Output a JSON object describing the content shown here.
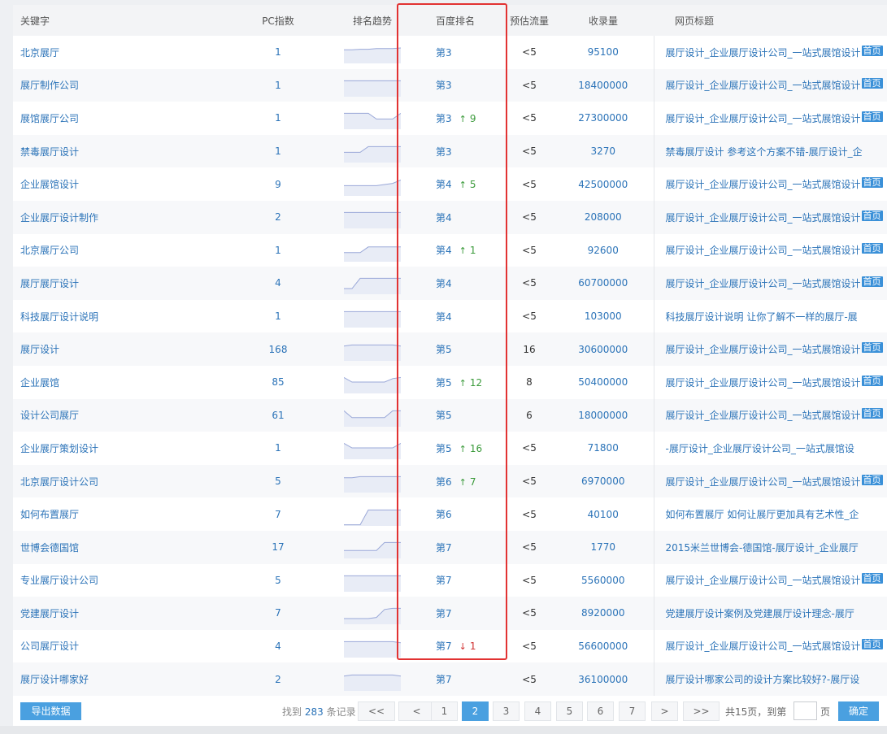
{
  "columns": {
    "keyword": "关键字",
    "pc_index": "PC指数",
    "trend": "排名趋势",
    "baidu_rank": "百度排名",
    "est_traffic": "预估流量",
    "indexed": "收录量",
    "page_title": "网页标题"
  },
  "badge_label": "首页",
  "rows": [
    {
      "keyword": "北京展厅",
      "pc": "1",
      "trend": [
        0.4,
        0.4,
        0.38,
        0.38,
        0.35,
        0.35,
        0.35,
        0.32
      ],
      "rank": "第3",
      "dir": "",
      "chg": "",
      "flow": "<5",
      "indexed": "95100",
      "title": "展厅设计_企业展厅设计公司_一站式展馆设计",
      "badge": true
    },
    {
      "keyword": "展厅制作公司",
      "pc": "1",
      "trend": [
        0.3,
        0.3,
        0.3,
        0.3,
        0.3,
        0.3,
        0.3,
        0.3
      ],
      "rank": "第3",
      "dir": "",
      "chg": "",
      "flow": "<5",
      "indexed": "18400000",
      "title": "展厅设计_企业展厅设计公司_一站式展馆设计",
      "badge": true
    },
    {
      "keyword": "展馆展厅公司",
      "pc": "1",
      "trend": [
        0.3,
        0.3,
        0.3,
        0.3,
        0.55,
        0.55,
        0.55,
        0.3
      ],
      "rank": "第3",
      "dir": "up",
      "chg": "9",
      "flow": "<5",
      "indexed": "27300000",
      "title": "展厅设计_企业展厅设计公司_一站式展馆设计",
      "badge": true
    },
    {
      "keyword": "禁毒展厅设计",
      "pc": "1",
      "trend": [
        0.55,
        0.55,
        0.55,
        0.3,
        0.3,
        0.3,
        0.3,
        0.3
      ],
      "rank": "第3",
      "dir": "",
      "chg": "",
      "flow": "<5",
      "indexed": "3270",
      "title": "禁毒展厅设计 参考这个方案不错-展厅设计_企",
      "badge": false
    },
    {
      "keyword": "企业展馆设计",
      "pc": "9",
      "trend": [
        0.55,
        0.55,
        0.55,
        0.55,
        0.55,
        0.5,
        0.45,
        0.3
      ],
      "rank": "第4",
      "dir": "up",
      "chg": "5",
      "flow": "<5",
      "indexed": "42500000",
      "title": "展厅设计_企业展厅设计公司_一站式展馆设计",
      "badge": true
    },
    {
      "keyword": "企业展厅设计制作",
      "pc": "2",
      "trend": [
        0.3,
        0.3,
        0.3,
        0.3,
        0.3,
        0.3,
        0.3,
        0.3
      ],
      "rank": "第4",
      "dir": "",
      "chg": "",
      "flow": "<5",
      "indexed": "208000",
      "title": "展厅设计_企业展厅设计公司_一站式展馆设计",
      "badge": true
    },
    {
      "keyword": "北京展厅公司",
      "pc": "1",
      "trend": [
        0.6,
        0.6,
        0.6,
        0.35,
        0.35,
        0.35,
        0.35,
        0.35
      ],
      "rank": "第4",
      "dir": "up",
      "chg": "1",
      "flow": "<5",
      "indexed": "92600",
      "title": "展厅设计_企业展厅设计公司_一站式展馆设计",
      "badge": true
    },
    {
      "keyword": "展厅展厅设计",
      "pc": "4",
      "trend": [
        0.75,
        0.75,
        0.3,
        0.3,
        0.3,
        0.3,
        0.3,
        0.3
      ],
      "rank": "第4",
      "dir": "",
      "chg": "",
      "flow": "<5",
      "indexed": "60700000",
      "title": "展厅设计_企业展厅设计公司_一站式展馆设计",
      "badge": true
    },
    {
      "keyword": "科技展厅设计说明",
      "pc": "1",
      "trend": [
        0.3,
        0.3,
        0.3,
        0.3,
        0.3,
        0.3,
        0.3,
        0.3
      ],
      "rank": "第4",
      "dir": "",
      "chg": "",
      "flow": "<5",
      "indexed": "103000",
      "title": "科技展厅设计说明 让你了解不一样的展厅-展",
      "badge": false
    },
    {
      "keyword": "展厅设计",
      "pc": "168",
      "trend": [
        0.35,
        0.3,
        0.3,
        0.3,
        0.3,
        0.3,
        0.3,
        0.35
      ],
      "rank": "第5",
      "dir": "",
      "chg": "",
      "flow": "16",
      "indexed": "30600000",
      "title": "展厅设计_企业展厅设计公司_一站式展馆设计",
      "badge": true
    },
    {
      "keyword": "企业展馆",
      "pc": "85",
      "trend": [
        0.3,
        0.5,
        0.5,
        0.5,
        0.5,
        0.5,
        0.35,
        0.3
      ],
      "rank": "第5",
      "dir": "up",
      "chg": "12",
      "flow": "8",
      "indexed": "50400000",
      "title": "展厅设计_企业展厅设计公司_一站式展馆设计",
      "badge": true
    },
    {
      "keyword": "设计公司展厅",
      "pc": "61",
      "trend": [
        0.3,
        0.6,
        0.6,
        0.6,
        0.6,
        0.6,
        0.3,
        0.3
      ],
      "rank": "第5",
      "dir": "",
      "chg": "",
      "flow": "6",
      "indexed": "18000000",
      "title": "展厅设计_企业展厅设计公司_一站式展馆设计",
      "badge": true
    },
    {
      "keyword": "企业展厅策划设计",
      "pc": "1",
      "trend": [
        0.3,
        0.5,
        0.5,
        0.5,
        0.5,
        0.5,
        0.5,
        0.3
      ],
      "rank": "第5",
      "dir": "up",
      "chg": "16",
      "flow": "<5",
      "indexed": "71800",
      "title": "-展厅设计_企业展厅设计公司_一站式展馆设",
      "badge": false
    },
    {
      "keyword": "北京展厅设计公司",
      "pc": "5",
      "trend": [
        0.35,
        0.35,
        0.3,
        0.3,
        0.3,
        0.3,
        0.3,
        0.3
      ],
      "rank": "第6",
      "dir": "up",
      "chg": "7",
      "flow": "<5",
      "indexed": "6970000",
      "title": "展厅设计_企业展厅设计公司_一站式展馆设计",
      "badge": true
    },
    {
      "keyword": "如何布置展厅",
      "pc": "7",
      "trend": [
        0.95,
        0.95,
        0.95,
        0.3,
        0.3,
        0.3,
        0.3,
        0.3
      ],
      "rank": "第6",
      "dir": "",
      "chg": "",
      "flow": "<5",
      "indexed": "40100",
      "title": "如何布置展厅 如何让展厅更加具有艺术性_企",
      "badge": false
    },
    {
      "keyword": "世博会德国馆",
      "pc": "17",
      "trend": [
        0.65,
        0.65,
        0.65,
        0.65,
        0.65,
        0.3,
        0.3,
        0.3
      ],
      "rank": "第7",
      "dir": "",
      "chg": "",
      "flow": "<5",
      "indexed": "1770",
      "title": "2015米兰世博会-德国馆-展厅设计_企业展厅",
      "badge": false
    },
    {
      "keyword": "专业展厅设计公司",
      "pc": "5",
      "trend": [
        0.3,
        0.3,
        0.3,
        0.3,
        0.3,
        0.3,
        0.3,
        0.3
      ],
      "rank": "第7",
      "dir": "",
      "chg": "",
      "flow": "<5",
      "indexed": "5560000",
      "title": "展厅设计_企业展厅设计公司_一站式展馆设计",
      "badge": true
    },
    {
      "keyword": "党建展厅设计",
      "pc": "7",
      "trend": [
        0.75,
        0.75,
        0.75,
        0.75,
        0.7,
        0.35,
        0.3,
        0.3
      ],
      "rank": "第7",
      "dir": "",
      "chg": "",
      "flow": "<5",
      "indexed": "8920000",
      "title": "党建展厅设计案例及党建展厅设计理念-展厅",
      "badge": false
    },
    {
      "keyword": "公司展厅设计",
      "pc": "4",
      "trend": [
        0.3,
        0.3,
        0.3,
        0.3,
        0.3,
        0.3,
        0.3,
        0.35
      ],
      "rank": "第7",
      "dir": "down",
      "chg": "1",
      "flow": "<5",
      "indexed": "56600000",
      "title": "展厅设计_企业展厅设计公司_一站式展馆设计",
      "badge": true
    },
    {
      "keyword": "展厅设计哪家好",
      "pc": "2",
      "trend": [
        0.35,
        0.3,
        0.3,
        0.3,
        0.3,
        0.3,
        0.3,
        0.35
      ],
      "rank": "第7",
      "dir": "",
      "chg": "",
      "flow": "<5",
      "indexed": "36100000",
      "title": "展厅设计哪家公司的设计方案比较好?-展厅设",
      "badge": false
    }
  ],
  "footer": {
    "export_label": "导出数据",
    "records_prefix": "找到",
    "records_count": "283",
    "records_suffix": "条记录",
    "first_label": "<<",
    "prev_label": "<",
    "pages": [
      "1",
      "2",
      "3",
      "4",
      "5",
      "6",
      "7"
    ],
    "active_page": "2",
    "next_label": ">",
    "last_label": ">>",
    "total_pages_label": "共15页，到第",
    "page_unit": "页",
    "confirm_label": "确定"
  },
  "colors": {
    "link": "#2b73b8",
    "up": "#3a9a3a",
    "down": "#d03030",
    "highlight": "#e23232",
    "accent": "#4aa0e0"
  }
}
